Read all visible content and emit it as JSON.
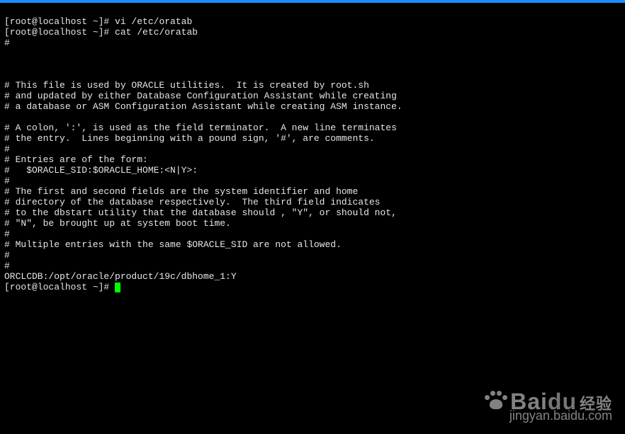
{
  "prompt": "[root@localhost ~]# ",
  "commands": {
    "cmd1": "vi /etc/oratab",
    "cmd2": "cat /etc/oratab"
  },
  "file_lines": [
    "#",
    "",
    "",
    "",
    "# This file is used by ORACLE utilities.  It is created by root.sh",
    "# and updated by either Database Configuration Assistant while creating",
    "# a database or ASM Configuration Assistant while creating ASM instance.",
    "",
    "# A colon, ':', is used as the field terminator.  A new line terminates",
    "# the entry.  Lines beginning with a pound sign, '#', are comments.",
    "#",
    "# Entries are of the form:",
    "#   $ORACLE_SID:$ORACLE_HOME:<N|Y>:",
    "#",
    "# The first and second fields are the system identifier and home",
    "# directory of the database respectively.  The third field indicates",
    "# to the dbstart utility that the database should , \"Y\", or should not,",
    "# \"N\", be brought up at system boot time.",
    "#",
    "# Multiple entries with the same $ORACLE_SID are not allowed.",
    "#",
    "#",
    "ORCLCDB:/opt/oracle/product/19c/dbhome_1:Y"
  ],
  "watermark": {
    "brand": "Bai",
    "brand2": "du",
    "cn": "经验",
    "sub": "jingyan.baidu.com"
  }
}
